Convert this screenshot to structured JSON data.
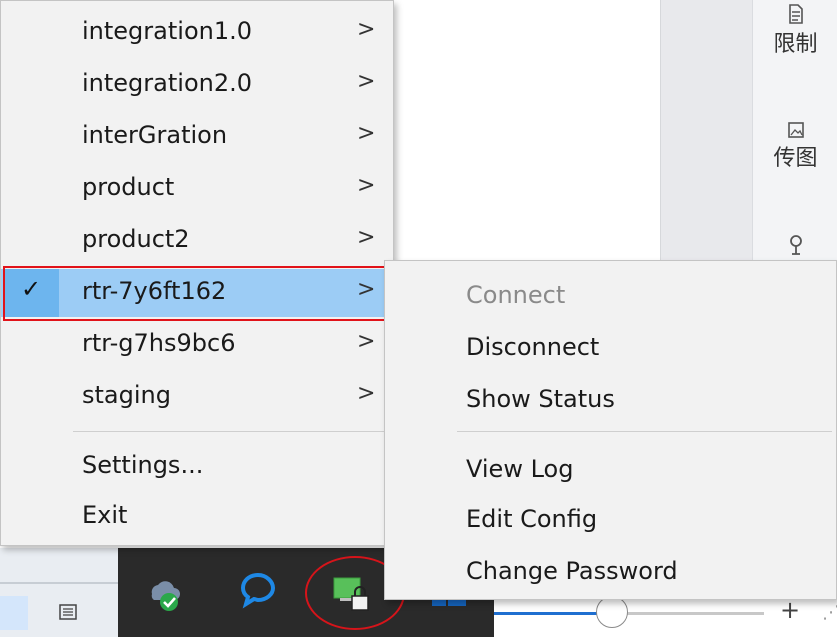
{
  "right_panel": {
    "items": [
      {
        "label": "限制",
        "icon": "document-icon"
      },
      {
        "label": "传图",
        "icon": "image-icon"
      },
      {
        "label": "",
        "icon": "person-icon"
      }
    ]
  },
  "menu": {
    "items": [
      {
        "label": "integration1.0",
        "arrow": ">"
      },
      {
        "label": "integration2.0",
        "arrow": ">"
      },
      {
        "label": "interGration",
        "arrow": ">"
      },
      {
        "label": "product",
        "arrow": ">"
      },
      {
        "label": "product2",
        "arrow": ">"
      },
      {
        "label": "rtr-7y6ft162",
        "arrow": ">",
        "checked": true
      },
      {
        "label": "rtr-g7hs9bc6",
        "arrow": ">"
      },
      {
        "label": "staging",
        "arrow": ">"
      }
    ],
    "bottom_items": [
      {
        "label": "Settings..."
      },
      {
        "label": "Exit"
      }
    ],
    "check_glyph": "✓"
  },
  "submenu": {
    "items": [
      {
        "label": "Connect",
        "disabled": true
      },
      {
        "label": "Disconnect"
      },
      {
        "label": "Show Status"
      }
    ],
    "bottom_items": [
      {
        "label": "View Log"
      },
      {
        "label": "Edit Config"
      },
      {
        "label": "Change Password"
      }
    ]
  },
  "taskbar": {
    "icons": [
      "cloud-sync-icon",
      "chat-bubble-icon",
      "vpn-lock-icon",
      "windows-icon"
    ]
  },
  "zoom": {
    "plus": "+",
    "level_fraction": 0.35
  },
  "colors": {
    "selection": "#9cccf5",
    "selection_check_bg": "#6db5ee",
    "highlight_outline": "#e1131a",
    "taskbar": "#2a2a2a"
  }
}
